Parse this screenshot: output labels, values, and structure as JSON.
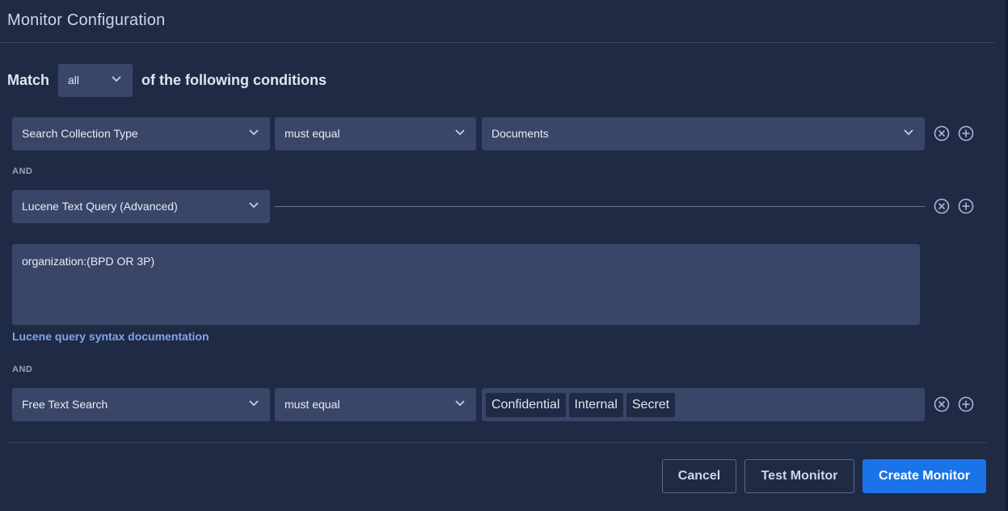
{
  "header": {
    "title": "Monitor Configuration"
  },
  "match": {
    "prefix": "Match",
    "selected": "all",
    "suffix": "of the following conditions"
  },
  "conditions": [
    {
      "field": "Search Collection Type",
      "operator": "must equal",
      "value": "Documents"
    },
    {
      "field": "Lucene Text Query (Advanced)",
      "query": "organization:(BPD OR 3P)",
      "doc_link": "Lucene query syntax documentation"
    },
    {
      "field": "Free Text Search",
      "operator": "must equal",
      "tags": [
        "Confidential",
        "Internal",
        "Secret"
      ]
    }
  ],
  "joiners": [
    "AND",
    "AND"
  ],
  "icons": {
    "remove": "close-circle-icon",
    "add": "plus-circle-icon",
    "dropdown": "chevron-down-icon"
  },
  "footer": {
    "cancel_label": "Cancel",
    "test_label": "Test Monitor",
    "create_label": "Create Monitor"
  },
  "colors": {
    "background": "#1f2a45",
    "field_bg": "#3a4668",
    "link": "#7ea7e6",
    "primary": "#1a73e8"
  }
}
